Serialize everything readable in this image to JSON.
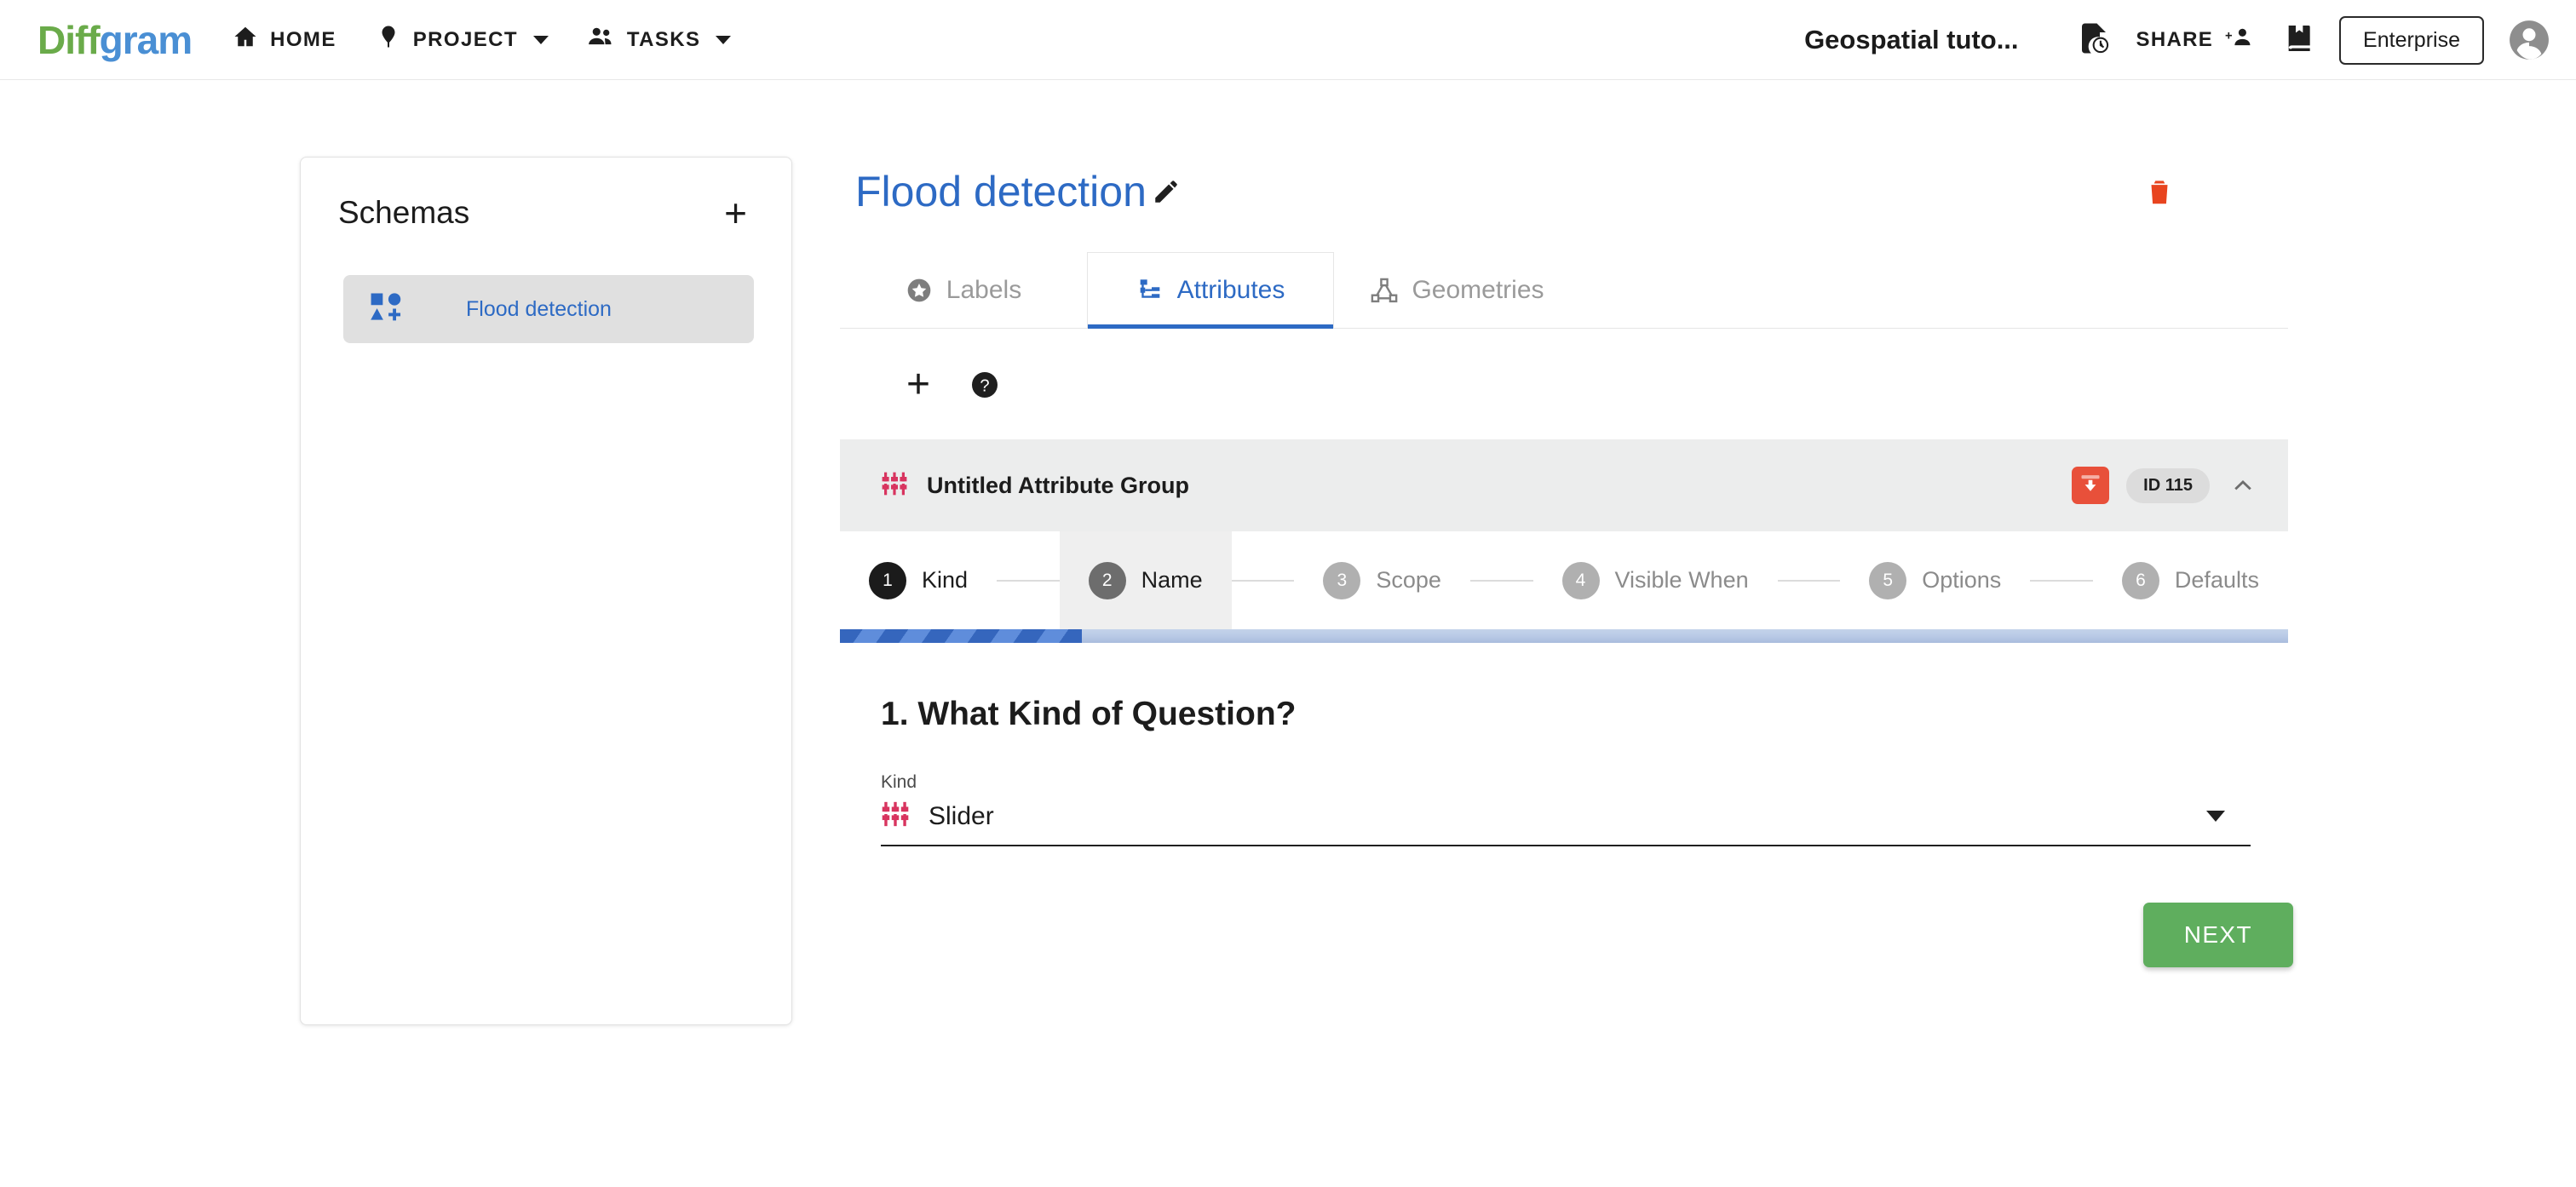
{
  "header": {
    "logo": {
      "part1": "Diff",
      "part2": "gram",
      "color1": "#6aab4a",
      "color2": "#4a8fd4"
    },
    "nav": [
      {
        "label": "HOME",
        "icon": "home-icon"
      },
      {
        "label": "PROJECT",
        "icon": "location-pin-icon",
        "caret": true
      },
      {
        "label": "TASKS",
        "icon": "people-icon",
        "caret": true
      }
    ],
    "project_title": "Geospatial tuto...",
    "pending_icon": "file-clock-icon",
    "share_label": "SHARE",
    "share_icon": "person-add-icon",
    "library_icon": "library-book-icon",
    "enterprise_label": "Enterprise",
    "avatar_icon": "account-circle-icon"
  },
  "sidebar": {
    "title": "Schemas",
    "add_label": "+",
    "items": [
      {
        "label": "Flood detection",
        "icon": "shapes-add-icon",
        "selected": true
      }
    ]
  },
  "main": {
    "schema_name": "Flood detection",
    "edit_icon": "pencil-icon",
    "delete_icon": "trash-icon",
    "delete_color": "#e8441f",
    "tabs": [
      {
        "label": "Labels",
        "icon": "star-circle-icon",
        "active": false
      },
      {
        "label": "Attributes",
        "icon": "account-tree-icon",
        "active": true
      },
      {
        "label": "Geometries",
        "icon": "vector-polygon-icon",
        "active": false
      }
    ],
    "accent_color": "#2d6ac4",
    "actions": {
      "add_label": "+",
      "add_name": "add-attribute-group-button",
      "help_icon": "help-circle-icon"
    },
    "attribute_group": {
      "icon": "slider-icon",
      "icon_color": "#d8345f",
      "title": "Untitled Attribute Group",
      "archive_icon": "archive-down-icon",
      "archive_color": "#e8503a",
      "id_badge": "ID 115",
      "collapse_icon": "chevron-up-icon"
    },
    "steps": [
      {
        "num": "1",
        "label": "Kind",
        "state": "active"
      },
      {
        "num": "2",
        "label": "Name",
        "state": "next"
      },
      {
        "num": "3",
        "label": "Scope",
        "state": "idle"
      },
      {
        "num": "4",
        "label": "Visible When",
        "state": "idle"
      },
      {
        "num": "5",
        "label": "Options",
        "state": "idle"
      },
      {
        "num": "6",
        "label": "Defaults",
        "state": "idle"
      }
    ],
    "progress": {
      "percent": 16.7,
      "fill_color": "#3566bd",
      "track_color": "#b9cae6"
    },
    "question": {
      "heading": "1. What Kind of Question?",
      "field_label": "Kind",
      "selected_value": "Slider",
      "select_icon": "slider-icon",
      "dropdown_icon": "caret-down-icon"
    },
    "next_button": {
      "label": "NEXT",
      "color": "#5fae5e"
    }
  }
}
